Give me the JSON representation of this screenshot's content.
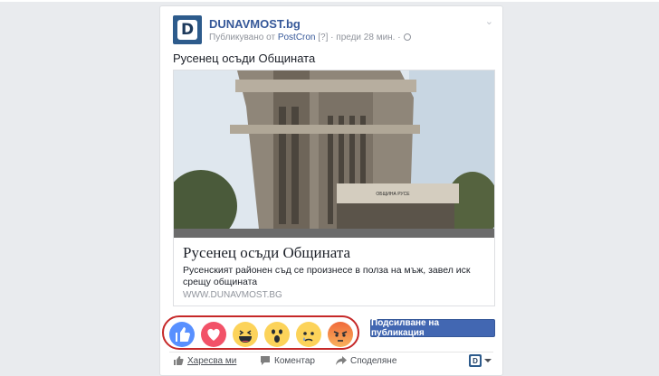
{
  "post": {
    "page_name": "DUNAVMOST.bg",
    "page_logo_letter": "D",
    "meta_prefix": "Публикувано от ",
    "meta_app": "PostCron",
    "meta_suffix": " [?] · преди 28 мин. ·",
    "text": "Русенец осъди Общината"
  },
  "link_preview": {
    "title": "Русенец осъди Общината",
    "description": "Русенският районен съд се произнесе в полза на мъж, завел иск срещу общината",
    "domain": "WWW.DUNAVMOST.BG",
    "building_sign": "ОБЩИНА РУСЕ"
  },
  "reactions": [
    "like-icon",
    "love-icon",
    "haha-icon",
    "wow-icon",
    "sad-icon",
    "angry-icon"
  ],
  "subscribe_button": "Подсилване на публикация",
  "actions": {
    "like": "Харесва ми",
    "comment": "Коментар",
    "share": "Споделяне"
  },
  "colors": {
    "brand": "#4267b2",
    "highlight_ring": "#c62828",
    "link": "#365899"
  }
}
